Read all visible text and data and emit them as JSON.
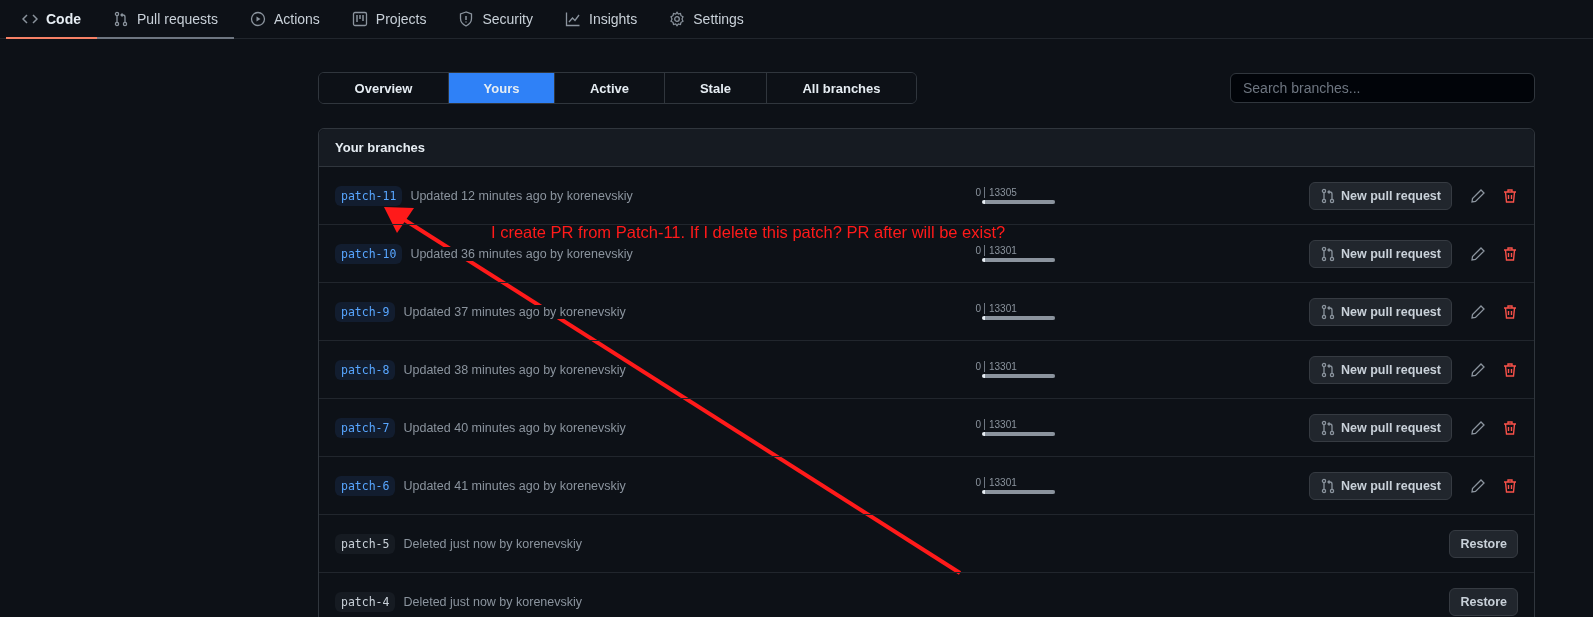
{
  "repo_nav": [
    {
      "label": "Code",
      "selected": true,
      "hovered": false
    },
    {
      "label": "Pull requests",
      "selected": false,
      "hovered": true
    },
    {
      "label": "Actions",
      "selected": false,
      "hovered": false
    },
    {
      "label": "Projects",
      "selected": false,
      "hovered": false
    },
    {
      "label": "Security",
      "selected": false,
      "hovered": false
    },
    {
      "label": "Insights",
      "selected": false,
      "hovered": false
    },
    {
      "label": "Settings",
      "selected": false,
      "hovered": false
    }
  ],
  "filter_tabs": [
    {
      "label": "Overview",
      "selected": false
    },
    {
      "label": "Yours",
      "selected": true
    },
    {
      "label": "Active",
      "selected": false
    },
    {
      "label": "Stale",
      "selected": false
    },
    {
      "label": "All branches",
      "selected": false
    }
  ],
  "search": {
    "placeholder": "Search branches..."
  },
  "branches": {
    "title": "Your branches",
    "rows": [
      {
        "kind": "active",
        "name": "patch-11",
        "info": "Updated 12 minutes ago by korenevskiy",
        "ahead": "0",
        "behind": "13305",
        "level": 1,
        "action": "New pull request"
      },
      {
        "kind": "active",
        "name": "patch-10",
        "info": "Updated 36 minutes ago by korenevskiy",
        "ahead": "0",
        "behind": "13301",
        "level": 1,
        "action": "New pull request"
      },
      {
        "kind": "active",
        "name": "patch-9",
        "info": "Updated 37 minutes ago by korenevskiy",
        "ahead": "0",
        "behind": "13301",
        "level": 1,
        "action": "New pull request"
      },
      {
        "kind": "active",
        "name": "patch-8",
        "info": "Updated 38 minutes ago by korenevskiy",
        "ahead": "0",
        "behind": "13301",
        "level": 1,
        "action": "New pull request"
      },
      {
        "kind": "active",
        "name": "patch-7",
        "info": "Updated 40 minutes ago by korenevskiy",
        "ahead": "0",
        "behind": "13301",
        "level": 1,
        "action": "New pull request"
      },
      {
        "kind": "active",
        "name": "patch-6",
        "info": "Updated 41 minutes ago by korenevskiy",
        "ahead": "0",
        "behind": "13301",
        "level": 1,
        "action": "New pull request"
      },
      {
        "kind": "deleted",
        "name": "patch-5",
        "info": "Deleted just now by korenevskiy",
        "action": "Restore"
      },
      {
        "kind": "deleted",
        "name": "patch-4",
        "info": "Deleted just now by korenevskiy",
        "action": "Restore"
      }
    ]
  },
  "annotation": {
    "text": "I create PR from Patch-11. If I delete this patch? PR after will be exist?"
  }
}
